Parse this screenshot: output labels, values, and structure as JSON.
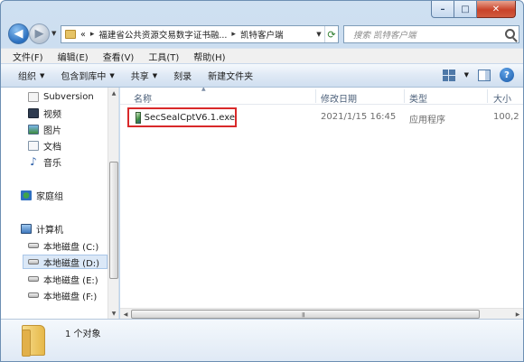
{
  "window": {
    "caption_min": "–",
    "caption_max": "□",
    "caption_close": "✕"
  },
  "address": {
    "history_symbol": "«",
    "segments": [
      "福建省公共资源交易数字证书融...",
      "凯特客户端"
    ],
    "separator": "▸",
    "search_placeholder": "搜索 凯特客户端"
  },
  "menu": [
    "文件(F)",
    "编辑(E)",
    "查看(V)",
    "工具(T)",
    "帮助(H)"
  ],
  "toolbar": {
    "organize": "组织",
    "include_library": "包含到库中",
    "share": "共享",
    "burn": "刻录",
    "new_folder": "新建文件夹",
    "help": "?"
  },
  "nav": [
    {
      "label": "Subversion",
      "icon": "subversion-icon"
    },
    {
      "label": "视频",
      "icon": "video-library-icon"
    },
    {
      "label": "图片",
      "icon": "pictures-library-icon"
    },
    {
      "label": "文档",
      "icon": "documents-library-icon"
    },
    {
      "label": "音乐",
      "icon": "music-library-icon"
    },
    {
      "label": "家庭组",
      "icon": "homegroup-icon"
    },
    {
      "label": "计算机",
      "icon": "computer-icon"
    },
    {
      "label": "本地磁盘 (C:)",
      "icon": "drive-c-icon"
    },
    {
      "label": "本地磁盘 (D:)",
      "icon": "drive-icon",
      "selected": true
    },
    {
      "label": "本地磁盘 (E:)",
      "icon": "drive-icon"
    },
    {
      "label": "本地磁盘 (F:)",
      "icon": "drive-icon"
    }
  ],
  "columns": {
    "name": "名称",
    "date": "修改日期",
    "type": "类型",
    "size": "大小"
  },
  "files": [
    {
      "name": "SecSealCptV6.1.exe",
      "date": "2021/1/15 16:45",
      "type": "应用程序",
      "size": "100,2",
      "icon": "exe-icon",
      "highlighted": true
    }
  ],
  "status": {
    "count_text": "1 个对象"
  },
  "colors": {
    "highlight_border": "#d9292a",
    "selection_bg": "#dbe8f7"
  }
}
